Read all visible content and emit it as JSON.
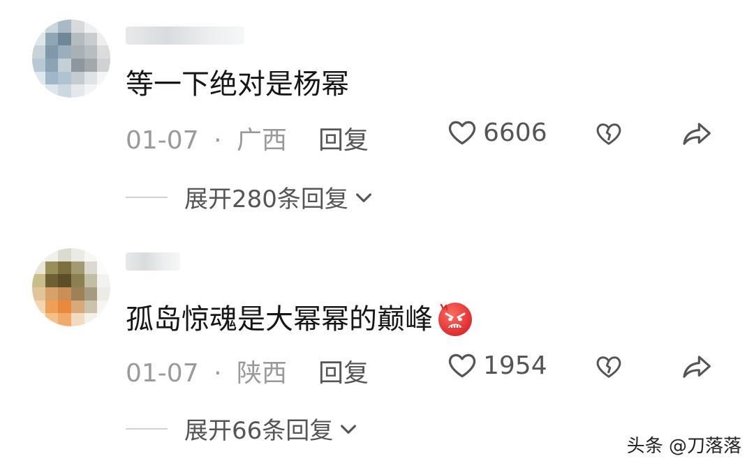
{
  "comments": [
    {
      "text": "等一下绝对是杨幂",
      "date": "01-07",
      "location": "广西",
      "reply_label": "回复",
      "likes": "6606",
      "expand_label": "展开280条回复"
    },
    {
      "text": "孤岛惊魂是大幂幂的巅峰",
      "emoji": "angry-face-icon",
      "date": "01-07",
      "location": "陕西",
      "reply_label": "回复",
      "likes": "1954",
      "expand_label": "展开66条回复"
    }
  ],
  "separator": "·",
  "watermark": "头条 @刀落落",
  "colors": {
    "meta_gray": "#9a9a9a",
    "action_gray": "#555555",
    "text": "#161616",
    "emoji_red": "#e23a3a"
  }
}
